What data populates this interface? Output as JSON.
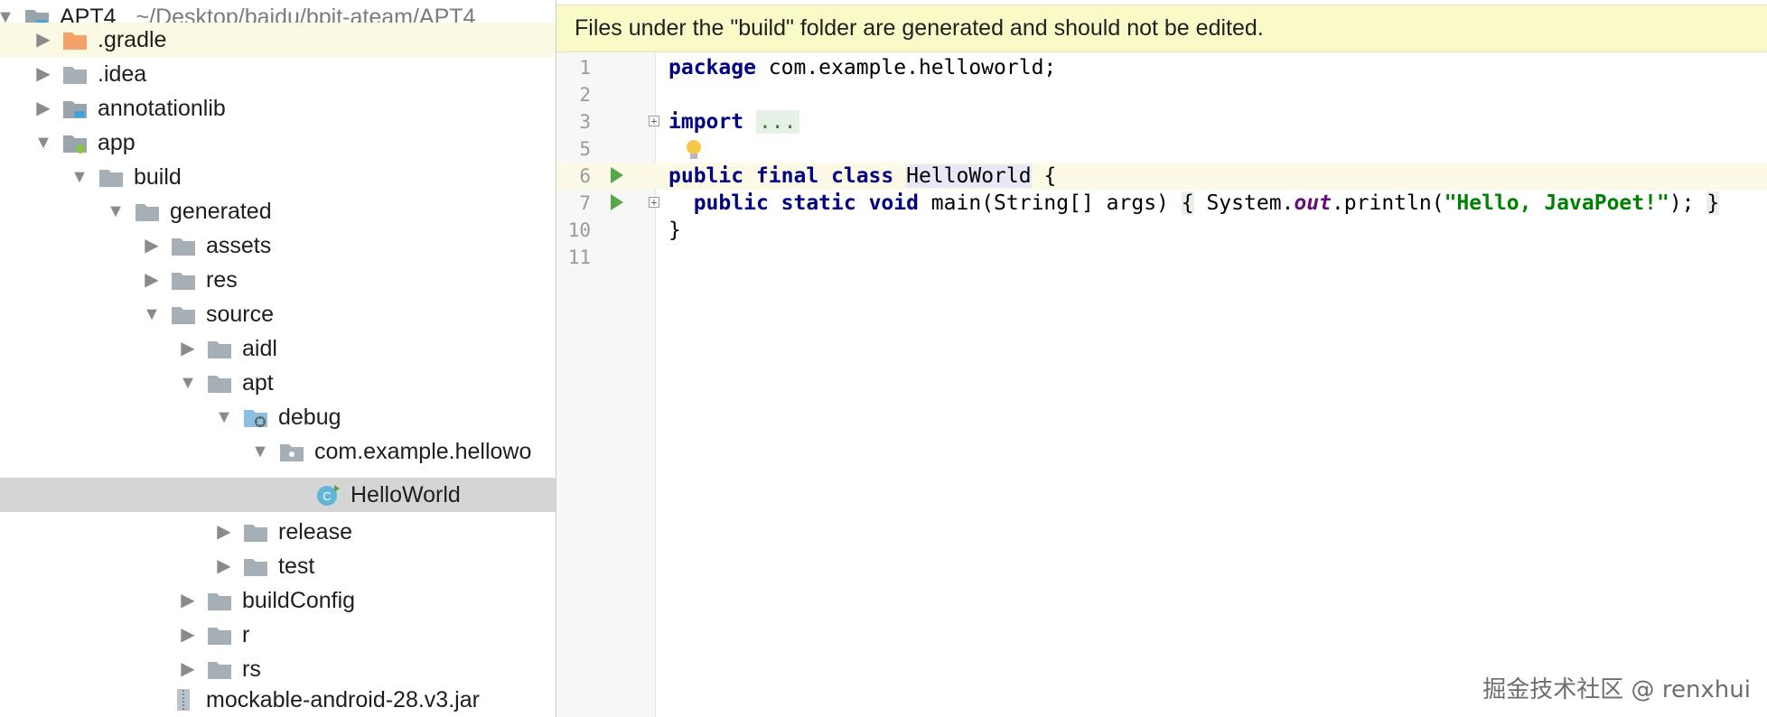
{
  "tree": {
    "root": {
      "label": "APT4",
      "path": "~/Desktop/baidu/bpit-ateam/APT4"
    },
    "items": [
      {
        "label": ".gradle"
      },
      {
        "label": ".idea"
      },
      {
        "label": "annotationlib"
      },
      {
        "label": "app"
      },
      {
        "label": "build"
      },
      {
        "label": "generated"
      },
      {
        "label": "assets"
      },
      {
        "label": "res"
      },
      {
        "label": "source"
      },
      {
        "label": "aidl"
      },
      {
        "label": "apt"
      },
      {
        "label": "debug"
      },
      {
        "label": "com.example.hellowo"
      },
      {
        "label": "HelloWorld"
      },
      {
        "label": "release"
      },
      {
        "label": "test"
      },
      {
        "label": "buildConfig"
      },
      {
        "label": "r"
      },
      {
        "label": "rs"
      },
      {
        "label": "mockable-android-28.v3.jar"
      }
    ]
  },
  "editor": {
    "banner": "Files under the \"build\" folder are generated and should not be edited.",
    "line_numbers": [
      "1",
      "2",
      "3",
      "5",
      "6",
      "7",
      "10",
      "11"
    ],
    "code": {
      "l1_kw": "package",
      "l1_rest": " com.example.helloworld;",
      "l3_kw": "import",
      "l3_fold": "...",
      "l6_kw": "public final class",
      "l6_ident": "HelloWorld",
      "l6_rest": " {",
      "l7_kw": "public static void",
      "l7_sig": " main(String[] args) ",
      "l7_open": "{",
      "l7_call": " System.",
      "l7_field": "out",
      "l7_method": ".println(",
      "l7_str": "\"Hello, JavaPoet!\"",
      "l7_end": "); ",
      "l7_close": "}",
      "l10": "}"
    }
  },
  "watermark": "掘金技术社区 @ renxhui",
  "colors": {
    "banner_bg": "#fafac8",
    "keyword": "#000080",
    "string": "#008000",
    "run_icon": "#57a64a",
    "selection": "#d5d5d5"
  }
}
